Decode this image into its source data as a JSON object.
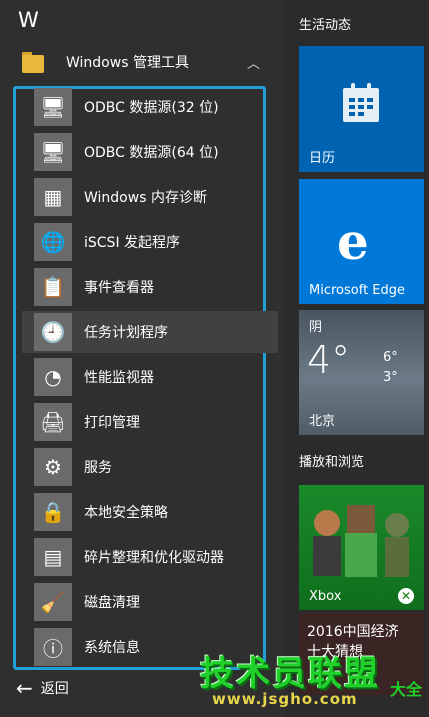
{
  "start_menu": {
    "group_letter": "W",
    "folder": {
      "label": "Windows 管理工具",
      "icon": "folder-icon",
      "expanded": true
    },
    "items": [
      {
        "label": "ODBC 数据源(32 位)",
        "icon": "odbc-icon"
      },
      {
        "label": "ODBC 数据源(64 位)",
        "icon": "odbc-icon"
      },
      {
        "label": "Windows 内存诊断",
        "icon": "memory-diagnostic-icon"
      },
      {
        "label": "iSCSI 发起程序",
        "icon": "iscsi-globe-icon"
      },
      {
        "label": "事件查看器",
        "icon": "event-viewer-icon"
      },
      {
        "label": "任务计划程序",
        "icon": "clock-icon"
      },
      {
        "label": "性能监视器",
        "icon": "gauge-icon"
      },
      {
        "label": "打印管理",
        "icon": "printer-icon"
      },
      {
        "label": "服务",
        "icon": "gears-icon"
      },
      {
        "label": "本地安全策略",
        "icon": "security-policy-icon"
      },
      {
        "label": "碎片整理和优化驱动器",
        "icon": "defrag-icon"
      },
      {
        "label": "磁盘清理",
        "icon": "disk-cleanup-icon"
      },
      {
        "label": "系统信息",
        "icon": "system-info-icon"
      }
    ],
    "back_label": "返回"
  },
  "tiles": {
    "section1_title": "生活动态",
    "section2_title": "播放和浏览",
    "calendar": {
      "label": "日历"
    },
    "edge": {
      "label": "Microsoft Edge",
      "glyph": "e"
    },
    "weather": {
      "condition": "阴",
      "temp": "4°",
      "high": "6°",
      "low": "3°",
      "city": "北京"
    },
    "xbox": {
      "label": "Xbox"
    },
    "news": {
      "line1": "2016中国经济",
      "line2": "十大猜想"
    }
  },
  "watermark": {
    "title": "技术员联盟",
    "url": "www.jsgho.com",
    "suffix": "大全"
  },
  "colors": {
    "accent_frame": "#21a0d8",
    "edge_blue": "#0078d7",
    "calendar_blue": "#0063b1",
    "xbox_green": "#107c10"
  }
}
